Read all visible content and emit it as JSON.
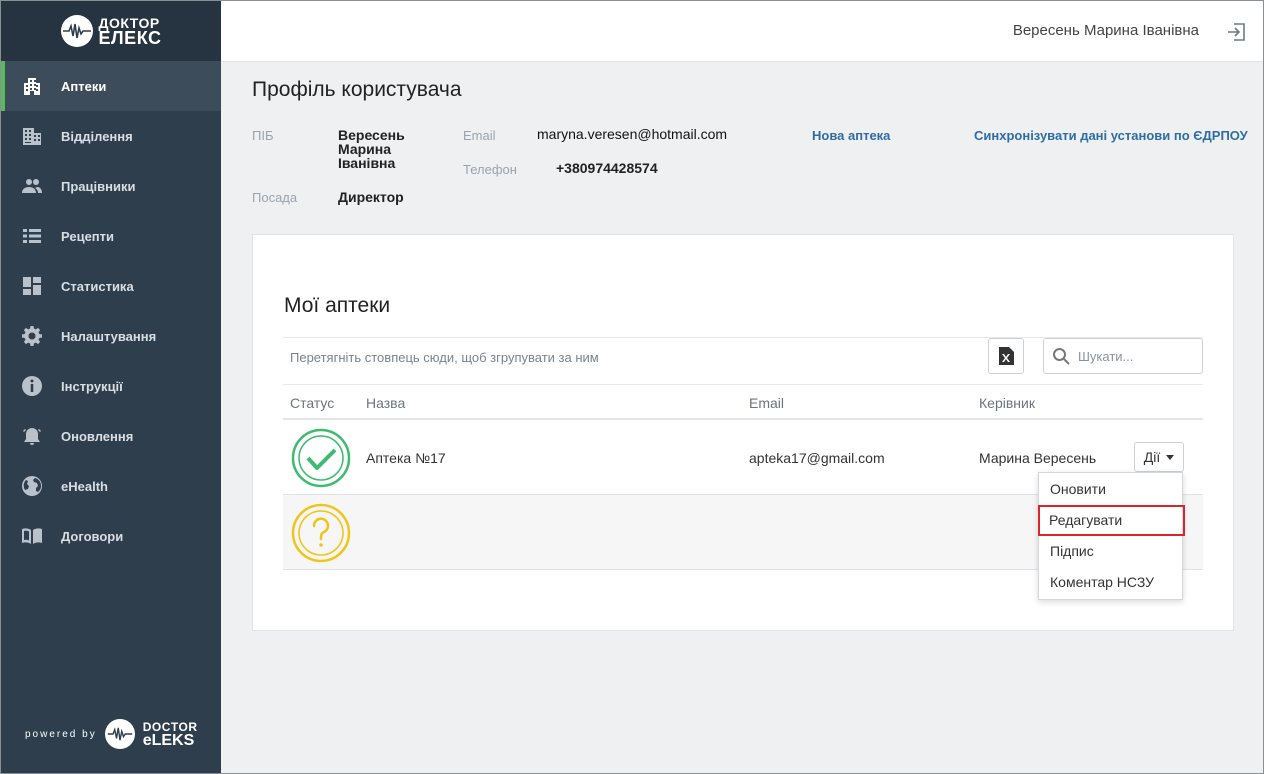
{
  "brand": {
    "line1": "ДОКТОР",
    "line2": "ЕЛЕКС"
  },
  "sidebar": {
    "items": [
      {
        "label": "Аптеки",
        "icon": "building-icon",
        "active": true
      },
      {
        "label": "Відділення",
        "icon": "office-icon"
      },
      {
        "label": "Працівники",
        "icon": "people-icon"
      },
      {
        "label": "Рецепти",
        "icon": "list-icon"
      },
      {
        "label": "Статистика",
        "icon": "dashboard-icon"
      },
      {
        "label": "Налаштування",
        "icon": "gear-icon"
      },
      {
        "label": "Інструкції",
        "icon": "info-icon"
      },
      {
        "label": "Оновлення",
        "icon": "bell-icon"
      },
      {
        "label": "eHealth",
        "icon": "globe-icon"
      },
      {
        "label": "Договори",
        "icon": "book-icon"
      }
    ],
    "powered_by": "powered by",
    "powered_brand": {
      "line1": "DOCTOR",
      "line2": "eLEKS"
    }
  },
  "header": {
    "user_name": "Вересень Марина Іванівна"
  },
  "profile": {
    "title": "Профіль користувача",
    "pib_label": "ПІБ",
    "pib_line1": "Вересень",
    "pib_line2": "Марина",
    "pib_line3": "Іванівна",
    "position_label": "Посада",
    "position_value": "Директор",
    "email_label": "Email",
    "email_value": "maryna.veresen@hotmail.com",
    "phone_label": "Телефон",
    "phone_value": "+380974428574",
    "new_pharmacy_link": "Нова аптека",
    "sync_link": "Синхронізувати дані установи по ЄДРПОУ"
  },
  "pharmacies": {
    "title": "Мої аптеки",
    "group_hint": "Перетягніть стовпець сюди, щоб згрупувати за ним",
    "search_placeholder": "Шукати...",
    "columns": {
      "status": "Статус",
      "name": "Назва",
      "email": "Email",
      "manager": "Керівник"
    },
    "rows": [
      {
        "status": "active",
        "name": "Аптека №17",
        "email": "apteka17@gmail.com",
        "manager": "Марина Вересень"
      },
      {
        "status": "unknown",
        "name": "",
        "email": "",
        "manager": ""
      }
    ],
    "actions_label": "Дії",
    "actions_menu": [
      "Оновити",
      "Редагувати",
      "Підпис",
      "Коментар НСЗУ"
    ]
  },
  "colors": {
    "sidebar": "#2f3e4c",
    "accent": "#5cb85c",
    "link": "#2e6da4",
    "status_ok": "#3dbb6e",
    "status_unknown": "#f0c419",
    "highlight": "#d9262b"
  }
}
